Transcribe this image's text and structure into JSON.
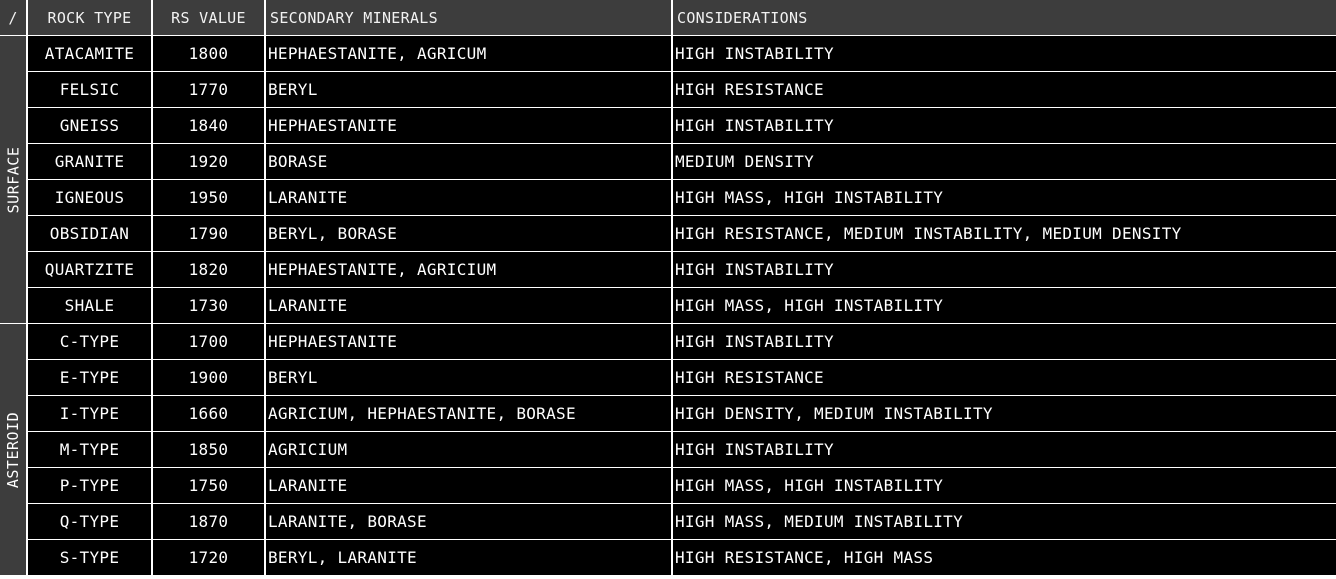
{
  "header": {
    "corner": "/",
    "rock_type": "ROCK TYPE",
    "rs_value": "RS VALUE",
    "secondary_minerals": "SECONDARY MINERALS",
    "considerations": "CONSIDERATIONS"
  },
  "groups": [
    {
      "label": "SURFACE",
      "rows": [
        {
          "rock": "ATACAMITE",
          "rs": "1800",
          "minerals": "HEPHAESTANITE, AGRICUM",
          "considerations": "HIGH INSTABILITY"
        },
        {
          "rock": "FELSIC",
          "rs": "1770",
          "minerals": "BERYL",
          "considerations": "HIGH RESISTANCE"
        },
        {
          "rock": "GNEISS",
          "rs": "1840",
          "minerals": "HEPHAESTANITE",
          "considerations": "HIGH INSTABILITY"
        },
        {
          "rock": "GRANITE",
          "rs": "1920",
          "minerals": "BORASE",
          "considerations": "MEDIUM DENSITY"
        },
        {
          "rock": "IGNEOUS",
          "rs": "1950",
          "minerals": "LARANITE",
          "considerations": "HIGH MASS, HIGH INSTABILITY"
        },
        {
          "rock": "OBSIDIAN",
          "rs": "1790",
          "minerals": "BERYL, BORASE",
          "considerations": "HIGH RESISTANCE, MEDIUM INSTABILITY, MEDIUM DENSITY"
        },
        {
          "rock": "QUARTZITE",
          "rs": "1820",
          "minerals": "HEPHAESTANITE, AGRICIUM",
          "considerations": "HIGH INSTABILITY"
        },
        {
          "rock": "SHALE",
          "rs": "1730",
          "minerals": "LARANITE",
          "considerations": "HIGH MASS, HIGH INSTABILITY"
        }
      ]
    },
    {
      "label": "ASTEROID",
      "rows": [
        {
          "rock": "C-TYPE",
          "rs": "1700",
          "minerals": "HEPHAESTANITE",
          "considerations": "HIGH INSTABILITY"
        },
        {
          "rock": "E-TYPE",
          "rs": "1900",
          "minerals": "BERYL",
          "considerations": "HIGH RESISTANCE"
        },
        {
          "rock": "I-TYPE",
          "rs": "1660",
          "minerals": "AGRICIUM, HEPHAESTANITE, BORASE",
          "considerations": "HIGH DENSITY, MEDIUM INSTABILITY"
        },
        {
          "rock": "M-TYPE",
          "rs": "1850",
          "minerals": "AGRICIUM",
          "considerations": "HIGH INSTABILITY"
        },
        {
          "rock": "P-TYPE",
          "rs": "1750",
          "minerals": "LARANITE",
          "considerations": "HIGH MASS, HIGH INSTABILITY"
        },
        {
          "rock": "Q-TYPE",
          "rs": "1870",
          "minerals": "LARANITE, BORASE",
          "considerations": "HIGH MASS, MEDIUM INSTABILITY"
        },
        {
          "rock": "S-TYPE",
          "rs": "1720",
          "minerals": "BERYL, LARANITE",
          "considerations": "HIGH RESISTANCE, HIGH MASS"
        }
      ]
    }
  ]
}
